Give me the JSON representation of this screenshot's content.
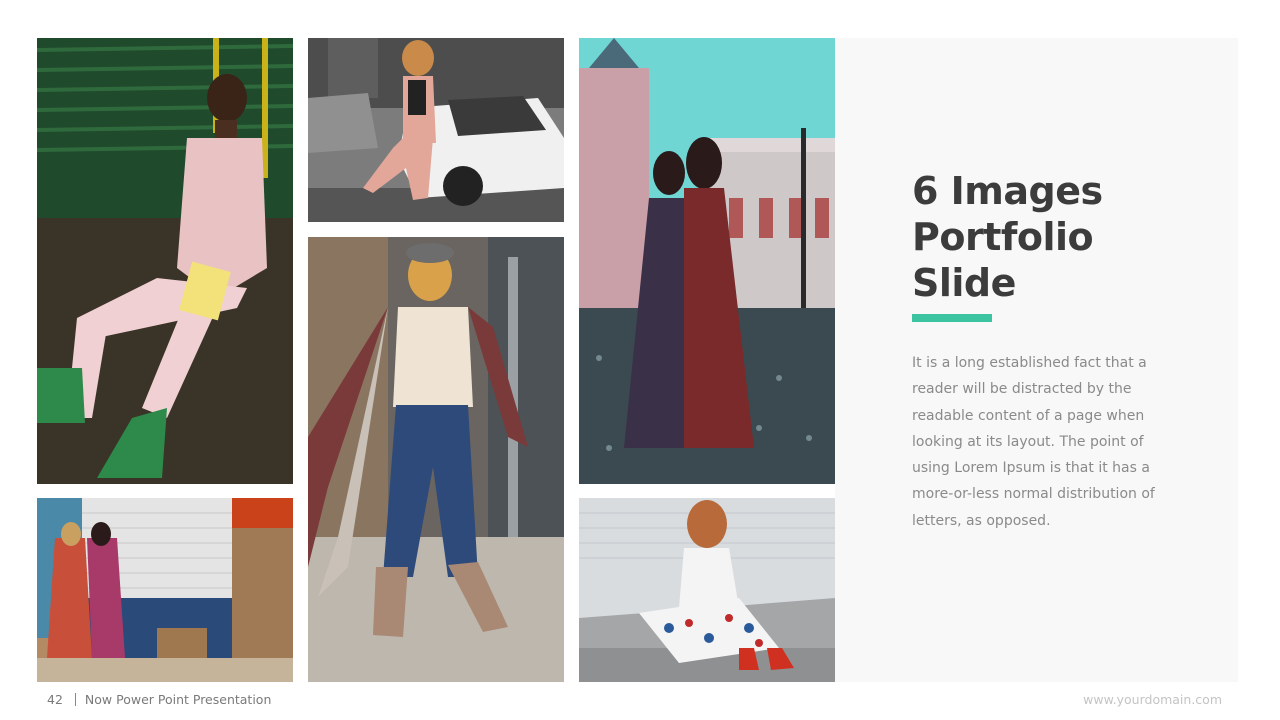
{
  "slide": {
    "title_lines": [
      "6 Images",
      "Portfolio",
      "Slide"
    ],
    "body": "It is a long established fact that a reader will be distracted by the readable content of a page when looking at its layout. The point of using Lorem Ipsum is that it has a more-or-less normal distribution of letters, as opposed.",
    "accent_color": "#3cc4a0"
  },
  "footer": {
    "page_number": "42",
    "presentation_name": "Now Power Point Presentation",
    "website": "www.yourdomain.com"
  }
}
